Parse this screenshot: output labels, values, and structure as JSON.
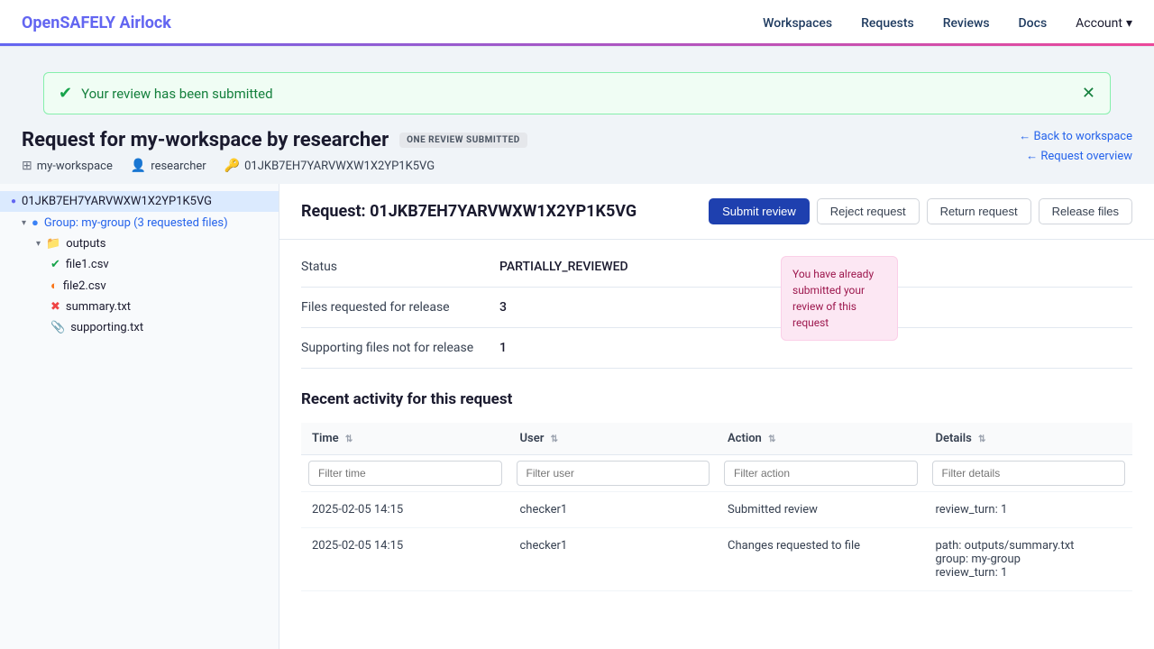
{
  "navbar": {
    "brand_open": "OpenSAFELY ",
    "brand_highlight": "Airlock",
    "links": [
      "Workspaces",
      "Requests",
      "Reviews",
      "Docs"
    ],
    "account_label": "Account"
  },
  "alert": {
    "text": "Your review has been submitted"
  },
  "page": {
    "title_prefix": "Request for my-workspace by",
    "title_researcher": "researcher",
    "badge": "ONE REVIEW SUBMITTED",
    "meta_workspace": "my-workspace",
    "meta_user": "researcher",
    "meta_id": "01JKB7EH7YARVWXW1X2YP1K5VG",
    "back_link": "← Back to workspace",
    "overview_link": "← Request overview"
  },
  "sidebar": {
    "root_id": "01JKB7EH7YARVWXW1X2YP1K5VG",
    "group_label": "Group: my-group (3 requested files)",
    "folder_label": "outputs",
    "files": [
      {
        "name": "file1.csv",
        "status": "green"
      },
      {
        "name": "file2.csv",
        "status": "orange"
      },
      {
        "name": "summary.txt",
        "status": "red"
      },
      {
        "name": "supporting.txt",
        "status": "gray"
      }
    ]
  },
  "request": {
    "title": "Request: 01JKB7EH7YARVWXW1X2YP1K5VG",
    "buttons": [
      "Submit review",
      "Reject request",
      "Return request",
      "Release files"
    ],
    "status_label": "Status",
    "status_value": "PARTIALLY_REVIEWED",
    "files_label": "Files requested for release",
    "files_value": "3",
    "supporting_label": "Supporting files not for release",
    "supporting_value": "1",
    "tooltip": "You have already submitted your review of this request"
  },
  "activity": {
    "title": "Recent activity for this request",
    "columns": [
      {
        "label": "Time",
        "filter_placeholder": "Filter time"
      },
      {
        "label": "User",
        "filter_placeholder": "Filter user"
      },
      {
        "label": "Action",
        "filter_placeholder": "Filter action"
      },
      {
        "label": "Details",
        "filter_placeholder": "Filter details"
      }
    ],
    "rows": [
      {
        "time": "2025-02-05 14:15",
        "user": "checker1",
        "action": "Submitted review",
        "details": "review_turn: 1"
      },
      {
        "time": "2025-02-05 14:15",
        "user": "checker1",
        "action": "Changes requested to file",
        "details_path": "path: outputs/summary.txt",
        "details_group": "group: my-group",
        "details_review": "review_turn: 1"
      }
    ]
  }
}
